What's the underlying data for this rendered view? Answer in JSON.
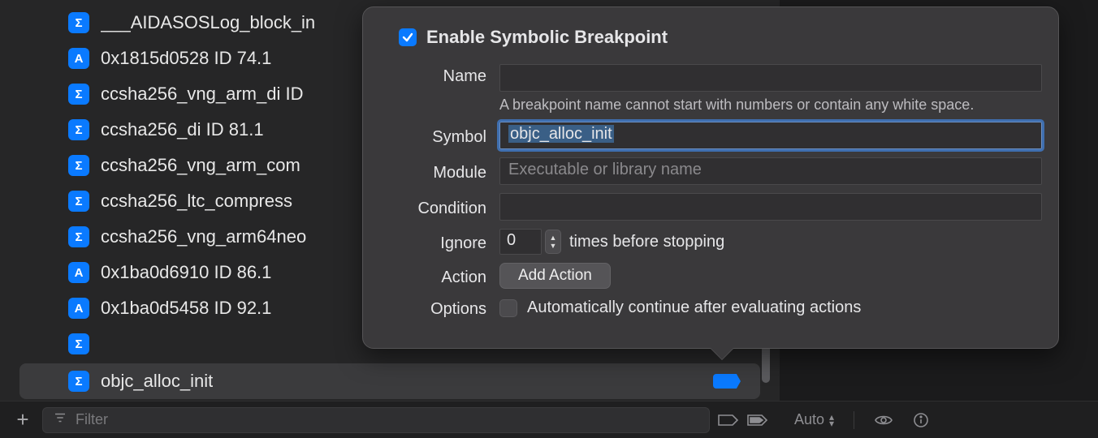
{
  "breakpoints": [
    {
      "iconGlyph": "Σ",
      "iconClass": "sigma",
      "label": "___AIDASOSLog_block_in"
    },
    {
      "iconGlyph": "A",
      "iconClass": "addr",
      "label": "0x1815d0528  ID 74.1"
    },
    {
      "iconGlyph": "Σ",
      "iconClass": "sigma",
      "label": "ccsha256_vng_arm_di ID"
    },
    {
      "iconGlyph": "Σ",
      "iconClass": "sigma",
      "label": "ccsha256_di  ID 81.1"
    },
    {
      "iconGlyph": "Σ",
      "iconClass": "sigma",
      "label": "ccsha256_vng_arm_com"
    },
    {
      "iconGlyph": "Σ",
      "iconClass": "sigma",
      "label": "ccsha256_ltc_compress"
    },
    {
      "iconGlyph": "Σ",
      "iconClass": "sigma",
      "label": "ccsha256_vng_arm64neo"
    },
    {
      "iconGlyph": "A",
      "iconClass": "addr",
      "label": "0x1ba0d6910  ID 86.1"
    },
    {
      "iconGlyph": "A",
      "iconClass": "addr",
      "label": "0x1ba0d5458  ID 92.1"
    },
    {
      "iconGlyph": "Σ",
      "iconClass": "sigma",
      "label": ""
    }
  ],
  "selected_breakpoint": {
    "iconGlyph": "Σ",
    "iconClass": "sigma",
    "label": "objc_alloc_init"
  },
  "filter": {
    "placeholder": "Filter"
  },
  "popover": {
    "enable_label": "Enable Symbolic Breakpoint",
    "labels": {
      "name": "Name",
      "symbol": "Symbol",
      "module": "Module",
      "condition": "Condition",
      "ignore": "Ignore",
      "action": "Action",
      "options": "Options"
    },
    "name_value": "",
    "name_note": "A breakpoint name cannot start with numbers or contain any white space.",
    "symbol_value": "objc_alloc_init",
    "module_placeholder": "Executable or library name",
    "condition_value": "",
    "ignore_value": "0",
    "ignore_suffix": "times before stopping",
    "add_action_label": "Add Action",
    "options_label": "Automatically continue after evaluating actions"
  },
  "right_footer": {
    "auto_label": "Auto"
  }
}
